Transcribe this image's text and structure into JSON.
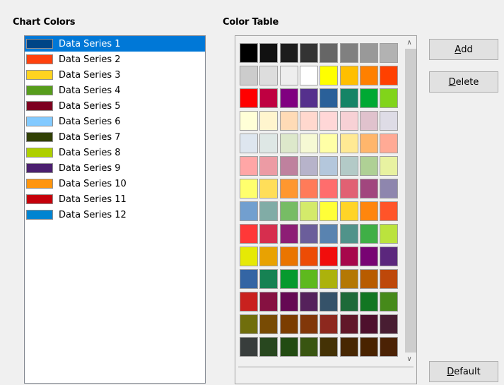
{
  "headings": {
    "chart_colors": "Chart Colors",
    "color_table": "Color Table"
  },
  "series": [
    {
      "label": "Data Series 1",
      "color": "#004586",
      "selected": true
    },
    {
      "label": "Data Series 2",
      "color": "#ff420e"
    },
    {
      "label": "Data Series 3",
      "color": "#ffd320"
    },
    {
      "label": "Data Series 4",
      "color": "#579d1c"
    },
    {
      "label": "Data Series 5",
      "color": "#7e0021"
    },
    {
      "label": "Data Series 6",
      "color": "#83caff"
    },
    {
      "label": "Data Series 7",
      "color": "#314004"
    },
    {
      "label": "Data Series 8",
      "color": "#aecf00"
    },
    {
      "label": "Data Series 9",
      "color": "#4b1f6f"
    },
    {
      "label": "Data Series 10",
      "color": "#ff950e"
    },
    {
      "label": "Data Series 11",
      "color": "#c5000b"
    },
    {
      "label": "Data Series 12",
      "color": "#0084d1"
    }
  ],
  "color_table": [
    [
      "#000000",
      "#111111",
      "#1c1c1c",
      "#333333",
      "#666666",
      "#808080",
      "#999999",
      "#b2b2b2"
    ],
    [
      "#cccccc",
      "#dddddd",
      "#eeeeee",
      "#ffffff",
      "#ffff00",
      "#ffbf00",
      "#ff8000",
      "#ff4000"
    ],
    [
      "#ff0000",
      "#bf0041",
      "#800080",
      "#55308d",
      "#2a6099",
      "#158466",
      "#00a933",
      "#81d41a"
    ],
    [
      "#ffffd7",
      "#fff5ce",
      "#ffdbb6",
      "#ffd8ce",
      "#ffd7d7",
      "#f7d1d5",
      "#e0c2cd",
      "#dedce6"
    ],
    [
      "#dee6ef",
      "#dee7e5",
      "#dde8cb",
      "#f6f9d4",
      "#ffffa6",
      "#ffe994",
      "#ffb66c",
      "#ffaa95"
    ],
    [
      "#ffa6a6",
      "#ec9ba4",
      "#bf819e",
      "#b7b3ca",
      "#b4c7dc",
      "#b3cac7",
      "#afd095",
      "#e8f2a1"
    ],
    [
      "#ffff6d",
      "#ffde59",
      "#ff972f",
      "#ff7b59",
      "#ff6d6d",
      "#e16173",
      "#a1467e",
      "#8e86ae"
    ],
    [
      "#729fcf",
      "#81aca6",
      "#77bc65",
      "#d4ea6b",
      "#ffff38",
      "#ffd428",
      "#ff860d",
      "#ff5429"
    ],
    [
      "#ff3838",
      "#d62e4e",
      "#8d1d75",
      "#6b5e9b",
      "#5983b0",
      "#50938a",
      "#3faf46",
      "#bbe33d"
    ],
    [
      "#e6e905",
      "#e8a202",
      "#ea7500",
      "#ed4c05",
      "#f10d0c",
      "#a7074b",
      "#780373",
      "#5b277d"
    ],
    [
      "#3465a4",
      "#168253",
      "#069a2e",
      "#5eb91e",
      "#acb20c",
      "#b47804",
      "#b85c00",
      "#be480a"
    ],
    [
      "#c9211e",
      "#861141",
      "#650953",
      "#55215b",
      "#355269",
      "#1e6a39",
      "#127622",
      "#468a1a"
    ],
    [
      "#706e0c",
      "#784b04",
      "#7b3d00",
      "#813709",
      "#8d281e",
      "#611729",
      "#4e102d",
      "#481d32"
    ],
    [
      "#383d3c",
      "#28471f",
      "#224b12",
      "#395511",
      "#443205",
      "#472702",
      "#492300",
      "#4b2204"
    ]
  ],
  "buttons": {
    "add": {
      "accel": "A",
      "rest": "dd"
    },
    "delete": {
      "accel": "D",
      "rest": "elete"
    },
    "default": {
      "accel": "D",
      "rest": "efault"
    }
  }
}
